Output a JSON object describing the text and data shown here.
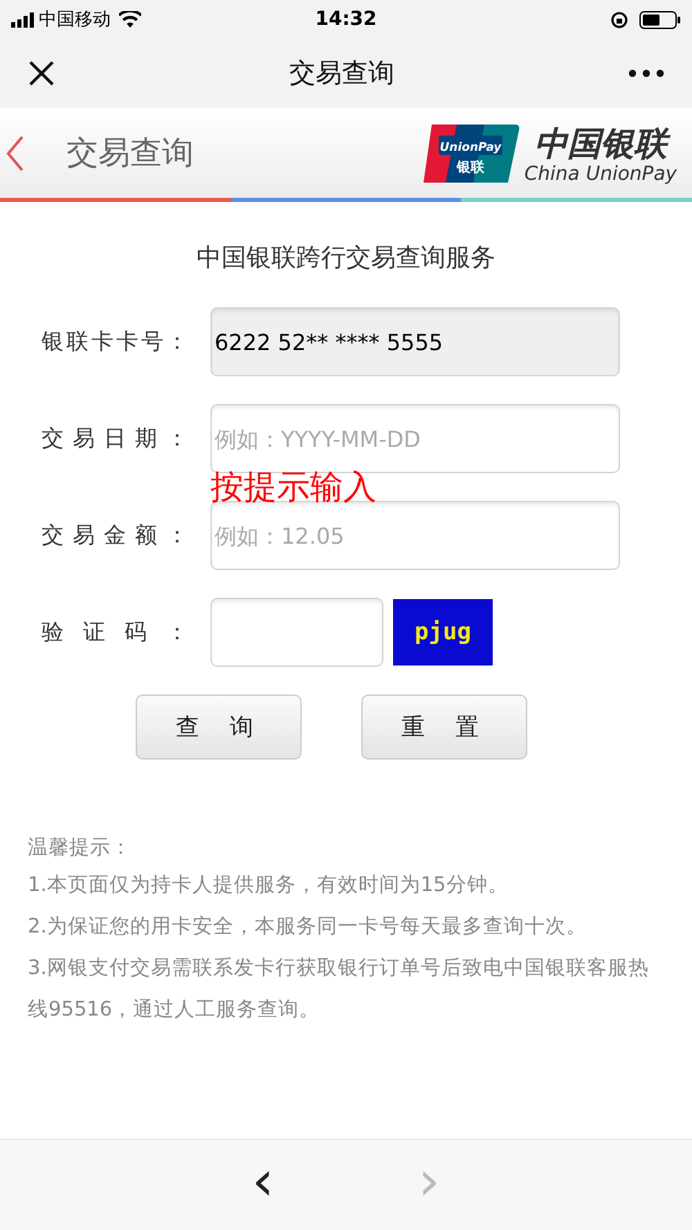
{
  "status_bar": {
    "carrier": "中国移动",
    "time": "14:32"
  },
  "nav_bar": {
    "title": "交易查询"
  },
  "header": {
    "title": "交易查询",
    "logo": {
      "card_top": "UnionPay",
      "card_bottom": "银联",
      "name_cn": "中国银联",
      "name_en": "China UnionPay"
    }
  },
  "form": {
    "heading": "中国银联跨行交易查询服务",
    "fields": [
      {
        "kind": "readonly",
        "label": "银联卡卡号：",
        "value": "6222 52** **** 5555"
      },
      {
        "kind": "text",
        "label": "交易日期：",
        "placeholder": "例如：YYYY-MM-DD"
      },
      {
        "kind": "text",
        "label": "交易金额：",
        "placeholder": "例如：12.05"
      },
      {
        "kind": "captcha",
        "label": "验证码：",
        "captcha": "pjug"
      }
    ],
    "annotation": "按提示输入",
    "buttons": [
      "查询",
      "重置"
    ]
  },
  "tips": {
    "title": "温馨提示：",
    "items": [
      "1.本页面仅为持卡人提供服务，有效时间为15分钟。",
      "2.为保证您的用卡安全，本服务同一卡号每天最多查询十次。",
      "3.网银支付交易需联系发卡行获取银行订单号后致电中国银联客服热线95516，通过人工服务查询。"
    ]
  },
  "bottom_bar": {
    "back": {
      "label": "‹",
      "disabled": false
    },
    "forward": {
      "label": "›",
      "disabled": true
    }
  }
}
